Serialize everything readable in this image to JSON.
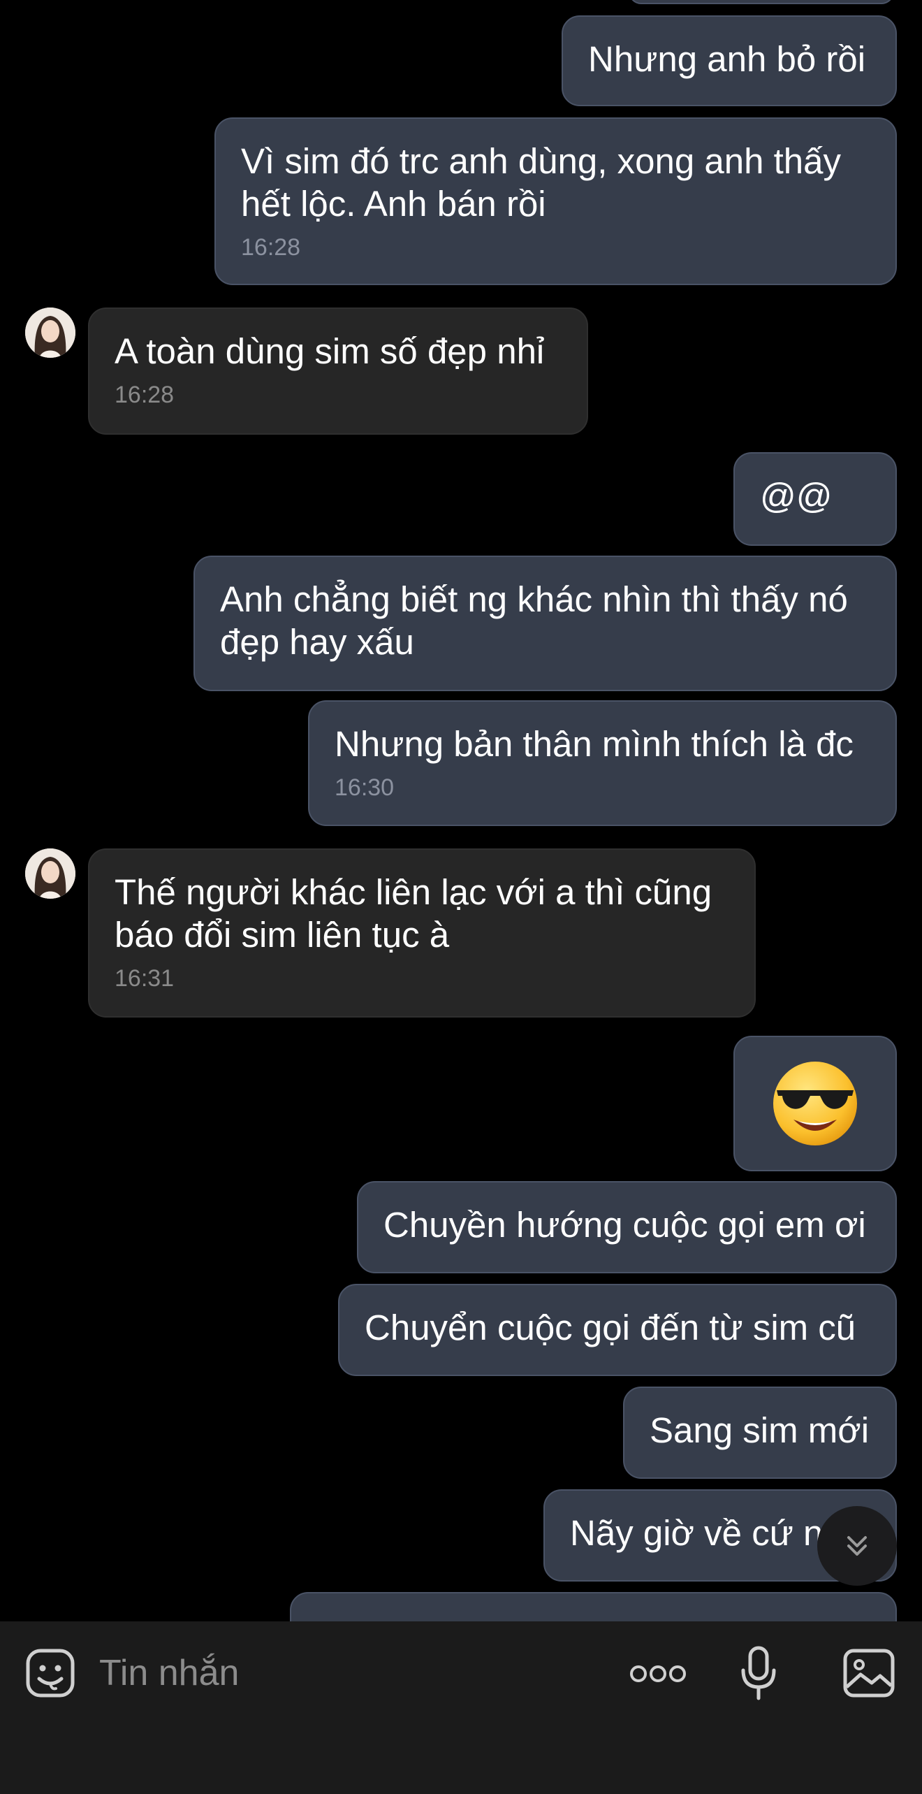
{
  "messages": [
    {
      "text": "Nhưng anh bỏ rồi",
      "time": ""
    },
    {
      "text": "Vì sim đó trc anh dùng, xong anh thấy hết lộc. Anh bán rồi",
      "time": "16:28"
    },
    {
      "text": "A toàn dùng sim số đẹp nhỉ",
      "time": "16:28"
    },
    {
      "text": "@@",
      "time": ""
    },
    {
      "text": "Anh chẳng biết ng khác nhìn thì thấy nó đẹp hay xấu",
      "time": ""
    },
    {
      "text": "Nhưng bản thân mình thích là đc",
      "time": "16:30"
    },
    {
      "text": "Thế người khác liên lạc với a thì cũng báo đổi sim liên tục à",
      "time": "16:31"
    },
    {
      "text": "",
      "time": "",
      "emoji": "sunglasses-emoji"
    },
    {
      "text": "Chuyền hướng cuộc gọi em ơi",
      "time": ""
    },
    {
      "text": "Chuyển cuộc gọi đến từ sim cũ",
      "time": ""
    },
    {
      "text": "Sang sim mới",
      "time": ""
    },
    {
      "text": "Nãy giờ về cứ n",
      "time": ""
    }
  ],
  "composer": {
    "placeholder": "Tin nhắn",
    "icons": [
      "sticker-icon",
      "more-icon",
      "microphone-icon",
      "image-icon"
    ]
  },
  "scroll_button_icon": "double-chevron-down-icon",
  "colors": {
    "background": "#000000",
    "outgoing_bubble": "#363d4b",
    "incoming_bubble": "#262626",
    "composer_bar": "#1b1b1b"
  }
}
